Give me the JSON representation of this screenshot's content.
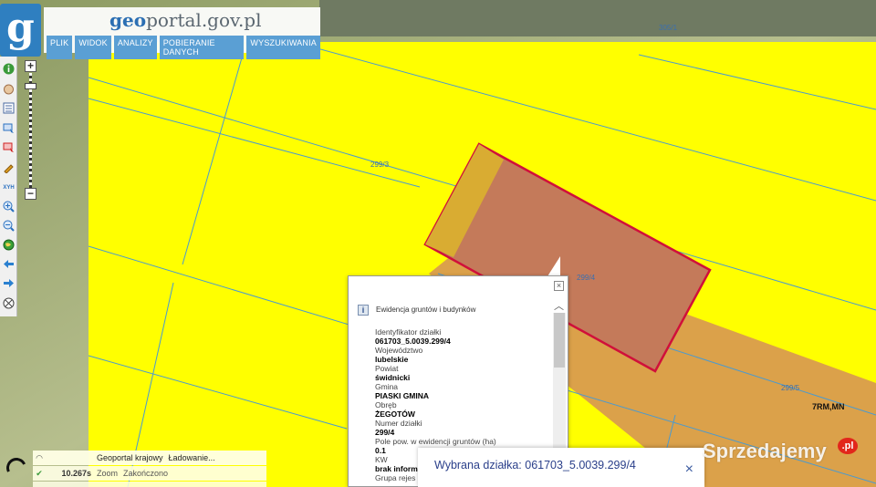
{
  "site": {
    "logo_letter": "g",
    "title_geo": "geo",
    "title_rest": "portal.gov.pl"
  },
  "menu": [
    "PLIK",
    "WIDOK",
    "ANALIZY",
    "POBIERANIE DANYCH",
    "WYSZUKIWANIA"
  ],
  "map": {
    "parcel_labels": [
      "305/1",
      "299/3",
      "299/4",
      "299/5"
    ],
    "land_use_label": "7RM,MN",
    "colors": {
      "parcel_fill": "#ffff00",
      "selected_fill": "#c47a5a",
      "selected_outline": "#d0103a",
      "orange_zone": "#dba14a",
      "boundary": "#4a9ad0"
    }
  },
  "zoom": {
    "plus": "+",
    "minus": "−"
  },
  "toolbar": {
    "icons": [
      "info-icon",
      "hand-icon",
      "legend-icon",
      "select-icon",
      "select-area-icon",
      "pencil-icon",
      "xyz-icon",
      "zoom-in-icon",
      "zoom-out-icon",
      "globe-icon",
      "arrow-left-icon",
      "arrow-right-icon",
      "compass-icon"
    ],
    "xyz_label": "XYH"
  },
  "popup": {
    "close": "×",
    "info_glyph": "i",
    "header": "Ewidencja gruntów i budynków",
    "fields": [
      {
        "label": "Identyfikator działki",
        "value": "061703_5.0039.299/4"
      },
      {
        "label": "Województwo",
        "value": "lubelskie"
      },
      {
        "label": "Powiat",
        "value": "świdnicki"
      },
      {
        "label": "Gmina",
        "value": "PIASKI GMINA"
      },
      {
        "label": "Obręb",
        "value": "ŻEGOTÓW"
      },
      {
        "label": "Numer działki",
        "value": "299/4"
      },
      {
        "label": "Pole pow. w ewidencji gruntów (ha)",
        "value": "0.1"
      },
      {
        "label": "KW",
        "value": "brak inform"
      },
      {
        "label": "Grupa rejes",
        "value": ""
      }
    ]
  },
  "status": {
    "rows": [
      {
        "icon": "",
        "time": "",
        "action": "Geoportal krajowy",
        "result": "Ładowanie..."
      },
      {
        "icon": "✔",
        "time": "10.267s",
        "action": "Zoom",
        "result": "Zakończono"
      }
    ]
  },
  "selected": {
    "text": "Wybrana działka: 061703_5.0039.299/4",
    "close": "×"
  },
  "watermark": {
    "text": "Sprzedajemy",
    "badge": ".pl"
  }
}
